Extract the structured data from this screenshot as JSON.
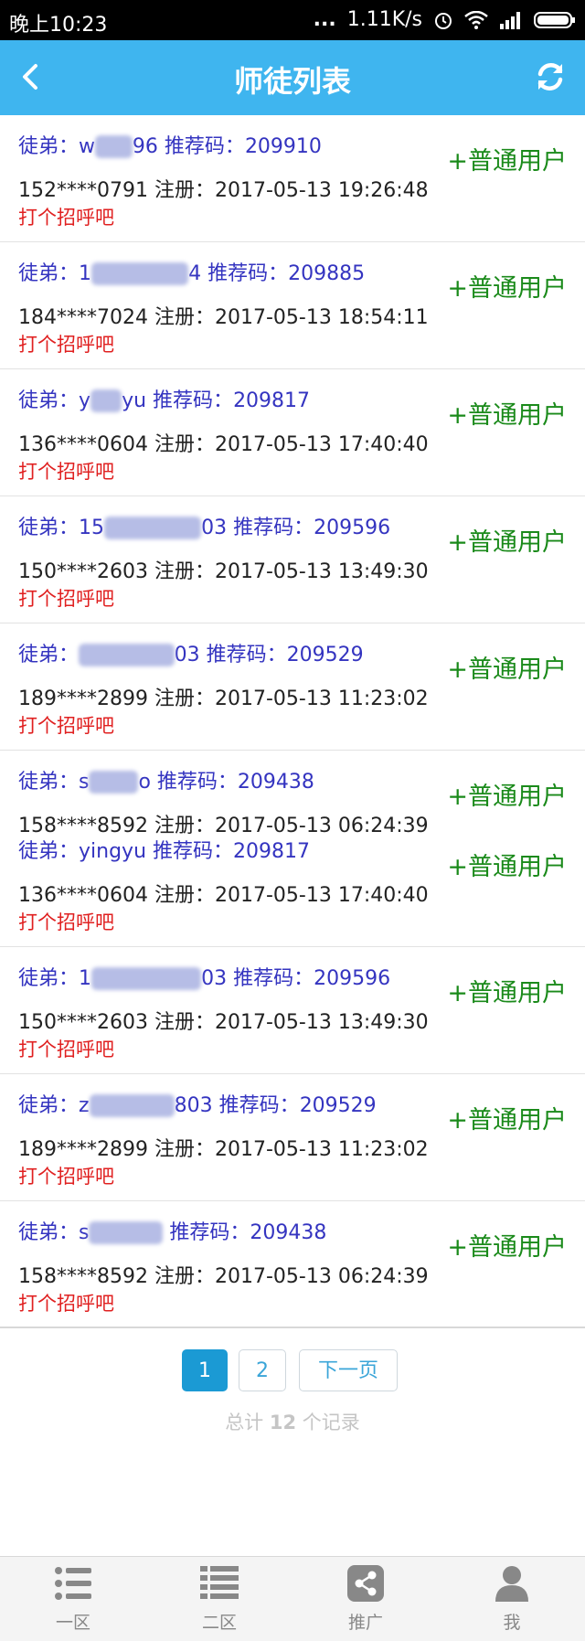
{
  "status_bar": {
    "time": "晚上10:23",
    "dots": "...",
    "speed": "1.11K/s"
  },
  "header": {
    "title": "师徒列表"
  },
  "rows": [
    {
      "prefix": "徒弟：",
      "name_visible": "w",
      "name_hidden": "aah",
      "name_tail": "96",
      "code_label": "推荐码：",
      "code": "209910",
      "phone": "152****0791",
      "reg_label": "注册：",
      "reg_time": "2017-05-13 19:26:48",
      "greet": "打个招呼吧",
      "type": "+普通用户"
    },
    {
      "prefix": "徒弟：",
      "name_visible": "1",
      "name_hidden": "84xxxxxx",
      "name_tail": "4",
      "code_label": "推荐码：",
      "code": "209885",
      "phone": "184****7024",
      "reg_label": "注册：",
      "reg_time": "2017-05-13 18:54:11",
      "greet": "打个招呼吧",
      "type": "+普通用户"
    },
    {
      "prefix": "徒弟：",
      "name_visible": "y",
      "name_hidden": "ing",
      "name_tail": "yu",
      "code_label": "推荐码：",
      "code": "209817",
      "phone": "136****0604",
      "reg_label": "注册：",
      "reg_time": "2017-05-13 17:40:40",
      "greet": "打个招呼吧",
      "type": "+普通用户"
    },
    {
      "prefix": "徒弟：",
      "name_visible": "15",
      "name_hidden": "0xxxxxx2",
      "name_tail": "03",
      "code_label": "推荐码：",
      "code": "209596",
      "phone": "150****2603",
      "reg_label": "注册：",
      "reg_time": "2017-05-13 13:49:30",
      "greet": "打个招呼吧",
      "type": "+普通用户"
    },
    {
      "prefix": "徒弟：",
      "name_visible": "",
      "name_hidden": "z8xxxxx6",
      "name_tail": "03",
      "code_label": "推荐码：",
      "code": "209529",
      "phone": "189****2899",
      "reg_label": "注册：",
      "reg_time": "2017-05-13 11:23:02",
      "greet": "打个招呼吧",
      "type": "+普通用户"
    },
    {
      "prefix": "徒弟：",
      "name_visible": "s",
      "name_hidden": "hxxb",
      "name_tail": "o",
      "code_label": "推荐码：",
      "code": "209438",
      "phone": "158****8592",
      "reg_label": "注册：",
      "reg_time": "2017-05-13 06:24:39",
      "greet": "",
      "type": "+普通用户",
      "extra": {
        "prefix": "徒弟：",
        "name": "yingyu",
        "code_label": "推荐码：",
        "code": "209817",
        "phone": "136****0604",
        "reg_label": "注册：",
        "reg_time": "2017-05-13 17:40:40",
        "greet": "打个招呼吧",
        "type": "+普通用户"
      }
    },
    {
      "prefix": "徒弟：",
      "name_visible": "1",
      "name_hidden": "50xxxxxx0",
      "name_tail": "03",
      "code_label": "推荐码：",
      "code": "209596",
      "phone": "150****2603",
      "reg_label": "注册：",
      "reg_time": "2017-05-13 13:49:30",
      "greet": "打个招呼吧",
      "type": "+普通用户"
    },
    {
      "prefix": "徒弟：",
      "name_visible": "z",
      "name_hidden": "8xxxxx5",
      "name_tail": "803",
      "code_label": "推荐码：",
      "code": "209529",
      "phone": "189****2899",
      "reg_label": "注册：",
      "reg_time": "2017-05-13 11:23:02",
      "greet": "打个招呼吧",
      "type": "+普通用户"
    },
    {
      "prefix": "徒弟：",
      "name_visible": "s",
      "name_hidden": "hxxbao",
      "name_tail": "",
      "code_label": "推荐码：",
      "code": "209438",
      "phone": "158****8592",
      "reg_label": "注册：",
      "reg_time": "2017-05-13 06:24:39",
      "greet": "打个招呼吧",
      "type": "+普通用户"
    }
  ],
  "pagination": {
    "page1": "1",
    "page2": "2",
    "next": "下一页",
    "total_prefix": "总计",
    "total_count": "12",
    "total_suffix": "个记录"
  },
  "tabs": [
    {
      "label": "一区",
      "icon": "list-icon"
    },
    {
      "label": "二区",
      "icon": "list-dense-icon"
    },
    {
      "label": "推广",
      "icon": "share-icon"
    },
    {
      "label": "我",
      "icon": "user-icon"
    }
  ],
  "colors": {
    "header_bg": "#3fb5ef",
    "name_color": "#3434c0",
    "greet_color": "#e02020",
    "type_color": "#1a8a1a",
    "pager_active": "#1b9ad4"
  }
}
